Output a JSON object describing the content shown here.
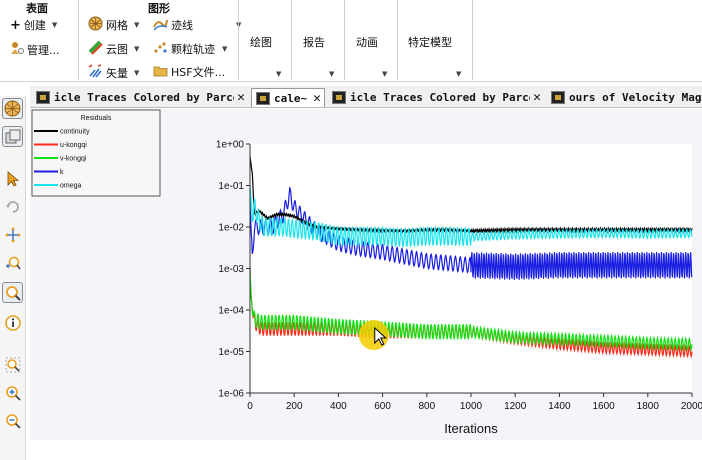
{
  "ribbon": {
    "surface": {
      "title": "表面",
      "create": "创建",
      "manage": "管理..."
    },
    "graphics": {
      "title": "图形",
      "mesh": "网格",
      "contour": "云图",
      "vector": "矢量",
      "pathline": "迹线",
      "particle_track": "颗粒轨迹",
      "hsf": "HSF文件..."
    },
    "plot": "绘图",
    "report": "报告",
    "animation": "动画",
    "model": "特定模型"
  },
  "tabs": [
    {
      "label": "icle Traces Colored by Parce",
      "active": false
    },
    {
      "label": "cale~",
      "active": true
    },
    {
      "label": "icle Traces Colored by Parce",
      "active": false
    },
    {
      "label": "ours of Velocity Magn",
      "active": false
    }
  ],
  "tab_close_glyph": "✕",
  "colors": {
    "continuity": "#000000",
    "u-kongqi": "#ff2a1a",
    "v-kongqi": "#12e012",
    "k": "#1a1ee0",
    "omega": "#18e4ee",
    "highlight": "#f4cc00"
  },
  "chart_data": {
    "type": "line",
    "legend_title": "Residuals",
    "legend_position": "top-left",
    "xlabel": "Iterations",
    "ylabel": "",
    "xlim": [
      0,
      2000
    ],
    "ylim": [
      1e-06,
      1
    ],
    "yscale": "log",
    "x_ticks": [
      "0",
      "200",
      "400",
      "600",
      "800",
      "1000",
      "1200",
      "1400",
      "1600",
      "1800",
      "2000"
    ],
    "y_ticks": [
      "1e+00",
      "1e-01",
      "1e-02",
      "1e-03",
      "1e-04",
      "1e-05",
      "1e-06"
    ],
    "series": [
      {
        "name": "continuity",
        "x": [
          0,
          10,
          20,
          40,
          80,
          120,
          160,
          200,
          260,
          300,
          400,
          500,
          600,
          700,
          800,
          900,
          1000,
          1200,
          1400,
          1600,
          1800,
          2000
        ],
        "y": [
          0.5,
          0.2,
          0.02,
          0.025,
          0.016,
          0.02,
          0.02,
          0.018,
          0.012,
          0.01,
          0.009,
          0.0085,
          0.0082,
          0.008,
          0.0085,
          0.0085,
          0.008,
          0.0085,
          0.0085,
          0.0085,
          0.0085,
          0.0085
        ]
      },
      {
        "name": "u-kongqi",
        "x": [
          0,
          5,
          20,
          50,
          100,
          200,
          400,
          600,
          800,
          1000,
          1200,
          1400,
          1600,
          1800,
          2000
        ],
        "y": [
          0.001,
          0.0002,
          5e-05,
          3.5e-05,
          3.5e-05,
          3.5e-05,
          3.5e-05,
          3e-05,
          3e-05,
          3e-05,
          2e-05,
          1.5e-05,
          1.2e-05,
          1.1e-05,
          1e-05
        ]
      },
      {
        "name": "v-kongqi",
        "x": [
          0,
          5,
          20,
          50,
          100,
          200,
          400,
          600,
          800,
          1000,
          1200,
          1400,
          1600,
          1800,
          2000
        ],
        "y": [
          0.001,
          0.0002,
          6e-05,
          5e-05,
          5e-05,
          5e-05,
          4e-05,
          3.5e-05,
          3e-05,
          3e-05,
          2.2e-05,
          2e-05,
          1.8e-05,
          1.6e-05,
          1.5e-05
        ]
      },
      {
        "name": "k",
        "x": [
          0,
          10,
          20,
          60,
          100,
          150,
          180,
          200,
          250,
          300,
          400,
          500,
          600,
          800,
          1000,
          1200,
          1400,
          1600,
          1800,
          2000
        ],
        "y": [
          0.04,
          0.002,
          0.01,
          0.01,
          0.01,
          0.02,
          0.06,
          0.03,
          0.015,
          0.008,
          0.004,
          0.003,
          0.0025,
          0.0015,
          0.0012,
          0.0011,
          0.0012,
          0.0012,
          0.0012,
          0.0012
        ]
      },
      {
        "name": "omega",
        "x": [
          0,
          10,
          20,
          40,
          60,
          100,
          150,
          200,
          300,
          400,
          500,
          600,
          700,
          800,
          900,
          1000,
          1200,
          1400,
          1600,
          1800,
          2000
        ],
        "y": [
          0.1,
          0.02,
          0.03,
          0.015,
          0.01,
          0.01,
          0.01,
          0.009,
          0.008,
          0.006,
          0.006,
          0.006,
          0.0055,
          0.006,
          0.006,
          0.0058,
          0.0065,
          0.0068,
          0.007,
          0.0068,
          0.007
        ]
      }
    ]
  }
}
